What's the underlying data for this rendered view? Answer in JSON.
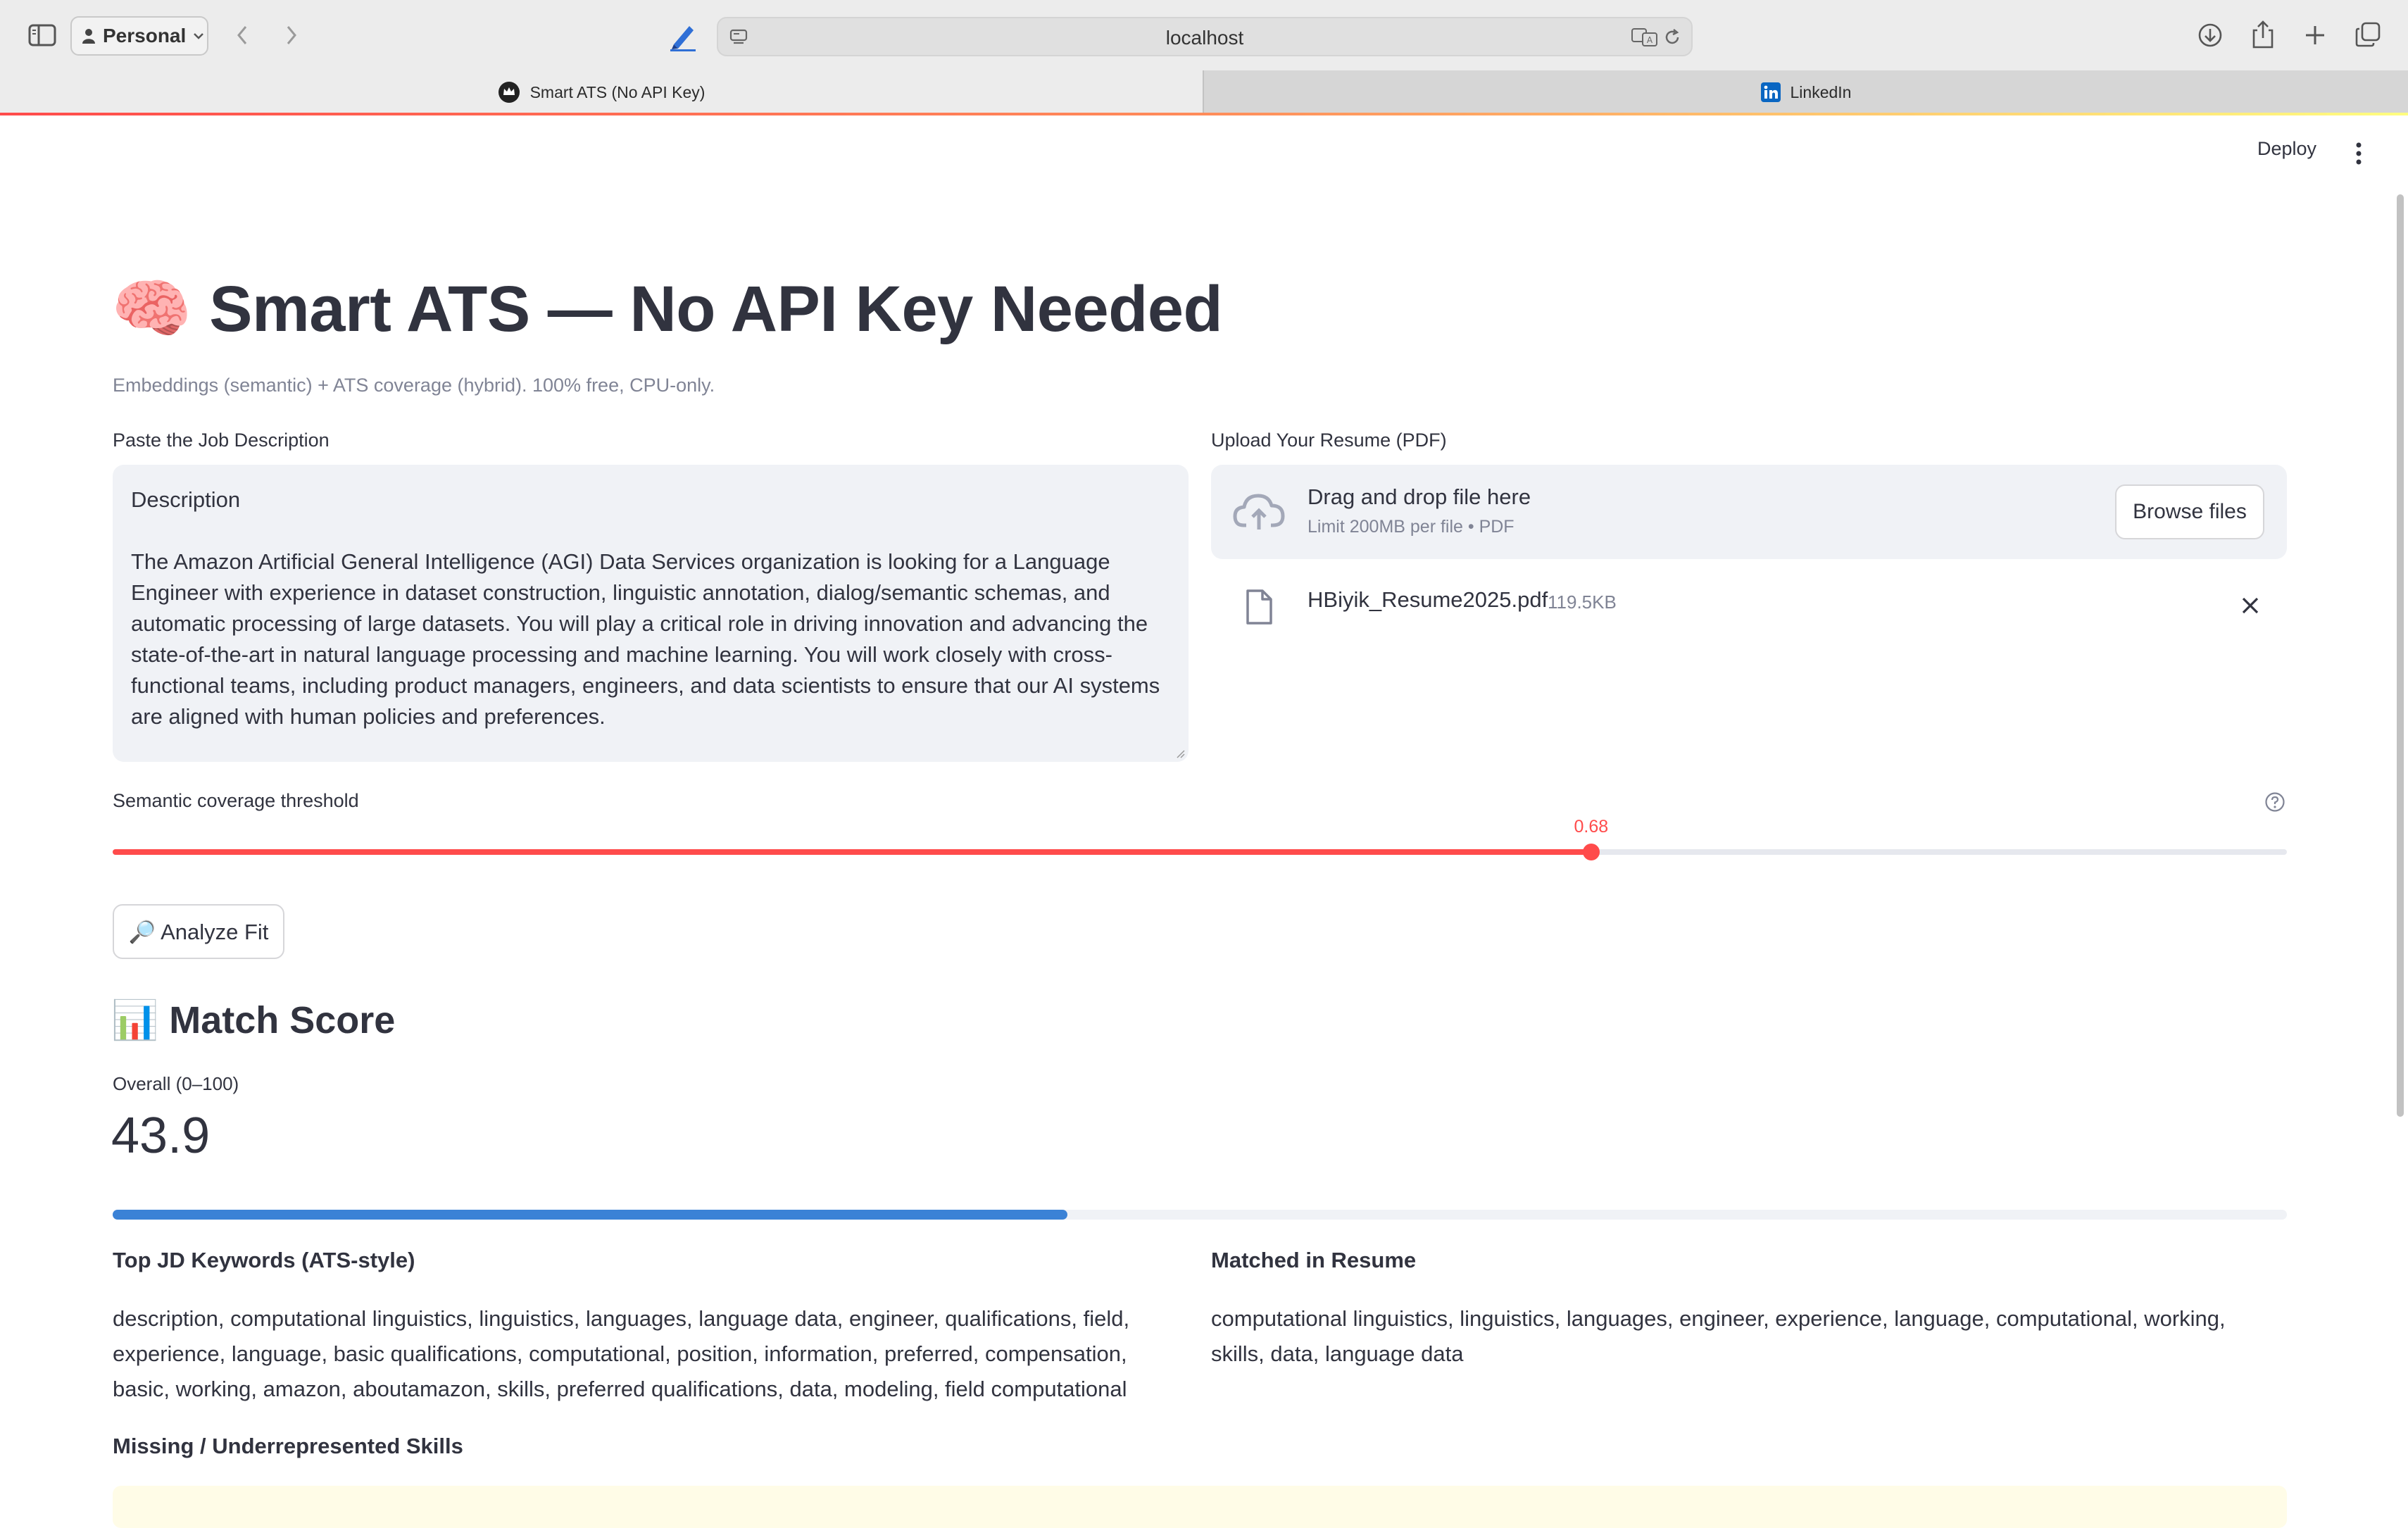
{
  "browser": {
    "profile": "Personal",
    "url": "localhost",
    "tabs": [
      {
        "label": "Smart ATS (No API Key)",
        "icon": "streamlit-crown-icon",
        "active": true
      },
      {
        "label": "LinkedIn",
        "icon": "linkedin-icon",
        "active": false
      }
    ]
  },
  "app": {
    "deploy_label": "Deploy",
    "title": "🧠 Smart ATS — No API Key Needed",
    "subtitle": "Embeddings (semantic) + ATS coverage (hybrid). 100% free, CPU-only.",
    "jd": {
      "label": "Paste the Job Description",
      "heading": "Description",
      "body": "The Amazon Artificial General Intelligence (AGI) Data Services organization is looking for a Language Engineer with experience in dataset construction, linguistic annotation, dialog/semantic schemas, and automatic processing of large datasets. You will play a critical role in driving innovation and advancing the state-of-the-art in natural language processing and machine learning. You will work closely with cross-functional teams, including product managers, engineers, and data scientists to ensure that our AI systems are aligned with human policies and preferences."
    },
    "upload": {
      "label": "Upload Your Resume (PDF)",
      "drop_title": "Drag and drop file here",
      "drop_sub": "Limit 200MB per file • PDF",
      "browse_label": "Browse files",
      "file_name": "HBiyik_Resume2025.pdf",
      "file_size": "119.5KB"
    },
    "slider": {
      "label": "Semantic coverage threshold",
      "value": 0.68,
      "value_label": "0.68",
      "min": 0,
      "max": 1
    },
    "analyze_label": "🔎 Analyze Fit",
    "match": {
      "heading": "📊 Match Score",
      "metric_label": "Overall (0–100)",
      "metric_value": "43.9",
      "progress": 43.9
    },
    "keywords": {
      "top_heading": "Top JD Keywords (ATS-style)",
      "top_text": "description, computational linguistics, linguistics, languages, language data, engineer, qualifications, field, experience, language, basic qualifications, computational, position, information, preferred, compensation, basic, working, amazon, aboutamazon, skills, preferred qualifications, data, modeling, field computational",
      "matched_heading": "Matched in Resume",
      "matched_text": "computational linguistics, linguistics, languages, engineer, experience, language, computational, working, skills, data, language data",
      "missing_heading": "Missing / Underrepresented Skills"
    }
  },
  "colors": {
    "accent": "#ff4b4b",
    "progress": "#3b82d6",
    "input_bg": "#f0f2f6"
  }
}
